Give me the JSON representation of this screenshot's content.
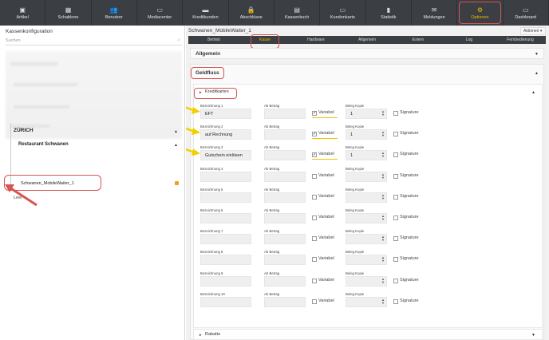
{
  "nav": [
    {
      "label": "Artikel",
      "icon": "box-icon",
      "glyph": "▣"
    },
    {
      "label": "Schablone",
      "icon": "grid-icon",
      "glyph": "▦"
    },
    {
      "label": "Benutzer",
      "icon": "users-icon",
      "glyph": "👥"
    },
    {
      "label": "Mediacenter",
      "icon": "monitor-icon",
      "glyph": "▭"
    },
    {
      "label": "Kreditkunden",
      "icon": "card-icon",
      "glyph": "▬"
    },
    {
      "label": "Abschlüsse",
      "icon": "lock-icon",
      "glyph": "🔒"
    },
    {
      "label": "Kassenbuch",
      "icon": "book-icon",
      "glyph": "▤"
    },
    {
      "label": "Kundenkarte",
      "icon": "id-card-icon",
      "glyph": "▭"
    },
    {
      "label": "Statistik",
      "icon": "chart-icon",
      "glyph": "▮"
    },
    {
      "label": "Meldungen",
      "icon": "message-icon",
      "glyph": "✉"
    },
    {
      "label": "Optionen",
      "icon": "gear-icon",
      "glyph": "⚙"
    },
    {
      "label": "Dashboard",
      "icon": "dashboard-icon",
      "glyph": "▭"
    }
  ],
  "left": {
    "title": "Kassenkonfiguration",
    "search_placeholder": "Suchen",
    "tree": {
      "city": "ZÜRICH",
      "restaurant": "Restaurant Schwanen",
      "device": "Schwanen_MobileWaiter_1",
      "empty": "Leer"
    }
  },
  "right": {
    "title": "Schwanen_MobileWaiter_1",
    "aktionen": "Aktionen ▾",
    "tabs": [
      "Betrieb",
      "Kasse",
      "Hardware",
      "Allgemein",
      "Extern",
      "Log",
      "Fernbedienung"
    ],
    "sections": {
      "allgemein": "Allgemein",
      "geldfluss": "Geldfluss",
      "kreditkarten": "Kreditkarten",
      "rabatte": "Rabatte"
    },
    "col_labels": {
      "ab_betrag": "Ab Betrag",
      "variabel": "Variabel",
      "beleg_kopie": "Beleg Kopie",
      "signature": "Signature"
    },
    "rows": [
      {
        "label": "Bezeichnung 1",
        "value": "EFT",
        "variabel": true,
        "kopie": "1"
      },
      {
        "label": "Bezeichnung 2",
        "value": "auf Rechnung",
        "variabel": true,
        "kopie": "1"
      },
      {
        "label": "Bezeichnung 3",
        "value": "Gutschein einlösen",
        "variabel": true,
        "kopie": "1"
      },
      {
        "label": "Bezeichnung 4",
        "value": "",
        "variabel": false,
        "kopie": ""
      },
      {
        "label": "Bezeichnung 5",
        "value": "",
        "variabel": false,
        "kopie": ""
      },
      {
        "label": "Bezeichnung 6",
        "value": "",
        "variabel": false,
        "kopie": ""
      },
      {
        "label": "Bezeichnung 7",
        "value": "",
        "variabel": false,
        "kopie": ""
      },
      {
        "label": "Bezeichnung 8",
        "value": "",
        "variabel": false,
        "kopie": ""
      },
      {
        "label": "Bezeichnung 9",
        "value": "",
        "variabel": false,
        "kopie": ""
      },
      {
        "label": "Bezeichnung 10",
        "value": "",
        "variabel": false,
        "kopie": ""
      }
    ]
  },
  "colors": {
    "nav_bg": "#3b3f44",
    "accent": "#f2b400",
    "highlight": "#d9534f",
    "arrow": "#f2d000"
  }
}
